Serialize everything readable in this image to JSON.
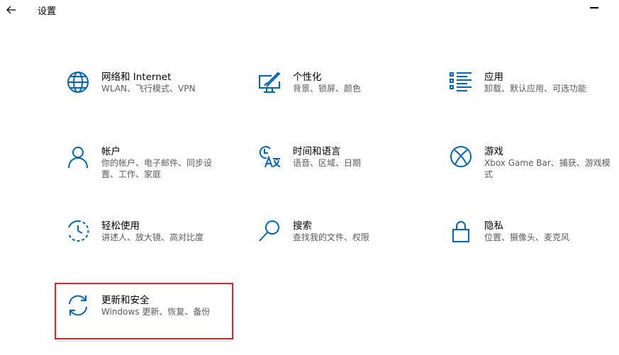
{
  "window": {
    "title": "设置"
  },
  "accent_color": "#0067c0",
  "tiles": [
    {
      "icon": "globe-icon",
      "label": "网络和 Internet",
      "desc": "WLAN、飞行模式、VPN"
    },
    {
      "icon": "personalization-icon",
      "label": "个性化",
      "desc": "背景、锁屏、颜色"
    },
    {
      "icon": "apps-icon",
      "label": "应用",
      "desc": "卸载、默认应用、可选功能"
    },
    {
      "icon": "person-icon",
      "label": "帐户",
      "desc": "你的帐户、电子邮件、同步设置、工作、家庭"
    },
    {
      "icon": "time-language-icon",
      "label": "时间和语言",
      "desc": "语音、区域、日期"
    },
    {
      "icon": "xbox-icon",
      "label": "游戏",
      "desc": "Xbox Game Bar、捕获、游戏模式"
    },
    {
      "icon": "ease-of-access-icon",
      "label": "轻松使用",
      "desc": "讲述人、放大镜、高对比度"
    },
    {
      "icon": "search-icon",
      "label": "搜索",
      "desc": "查找我的文件、权限"
    },
    {
      "icon": "lock-icon",
      "label": "隐私",
      "desc": "位置、摄像头、麦克风"
    },
    {
      "icon": "update-icon",
      "label": "更新和安全",
      "desc": "Windows 更新、恢复、备份"
    }
  ]
}
